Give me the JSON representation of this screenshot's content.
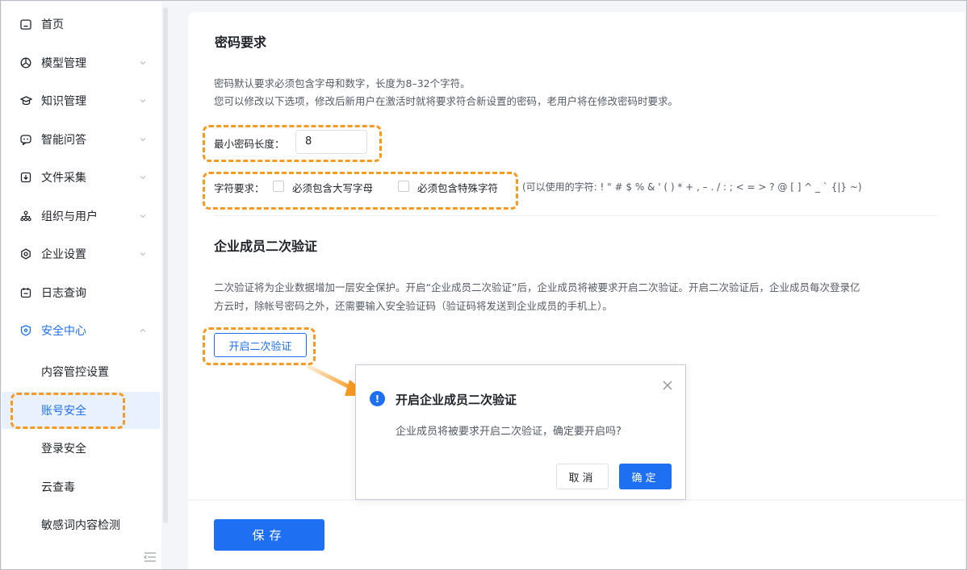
{
  "colors": {
    "accent": "#1f6ff2",
    "highlight": "#f59a23",
    "selected_bg": "#e9f1ff"
  },
  "sidebar": {
    "items": [
      {
        "label": "首页",
        "icon": "home-icon"
      },
      {
        "label": "模型管理",
        "icon": "model-icon"
      },
      {
        "label": "知识管理",
        "icon": "knowledge-icon"
      },
      {
        "label": "智能问答",
        "icon": "chat-icon"
      },
      {
        "label": "文件采集",
        "icon": "file-collect-icon"
      },
      {
        "label": "组织与用户",
        "icon": "org-icon"
      },
      {
        "label": "企业设置",
        "icon": "gear-icon"
      },
      {
        "label": "日志查询",
        "icon": "log-icon"
      },
      {
        "label": "安全中心",
        "icon": "shield-icon"
      }
    ],
    "sub_items": [
      {
        "label": "内容管控设置"
      },
      {
        "label": "账号安全"
      },
      {
        "label": "登录安全"
      },
      {
        "label": "云查毒"
      },
      {
        "label": "敏感词内容检测"
      }
    ]
  },
  "password": {
    "title": "密码要求",
    "desc_line1": "密码默认要求必须包含字母和数字，长度为8–32个字符。",
    "desc_line2": "您可以修改以下选项，修改后新用户在激活时就将要求符合新设置的密码，老用户将在修改密码时要求。",
    "min_length_label": "最小密码长度：",
    "min_length_value": "8",
    "char_req_label": "字符要求：",
    "opt_uppercase": "必须包含大写字母",
    "opt_special": "必须包含特殊字符",
    "allowed_chars": "(可以使用的字符: ! \" # $ % & ' ( ) * + , – . / : ; < = > ? @ [ ] ^ _ ` {|} ~)"
  },
  "twofa": {
    "title": "企业成员二次验证",
    "desc_line1": "二次验证将为企业数据增加一层安全保护。开启“企业成员二次验证”后，企业成员将被要求开启二次验证。开启二次验证后，企业成员每次登录亿",
    "desc_line2": "方云时，除帐号密码之外，还需要输入安全验证码（验证码将发送到企业成员的手机上）。",
    "enable_button": "开启二次验证"
  },
  "dialog": {
    "title": "开启企业成员二次验证",
    "message": "企业成员将被要求开启二次验证，确定要开启吗?",
    "cancel": "取消",
    "confirm": "确定"
  },
  "footer": {
    "save": "保存"
  }
}
